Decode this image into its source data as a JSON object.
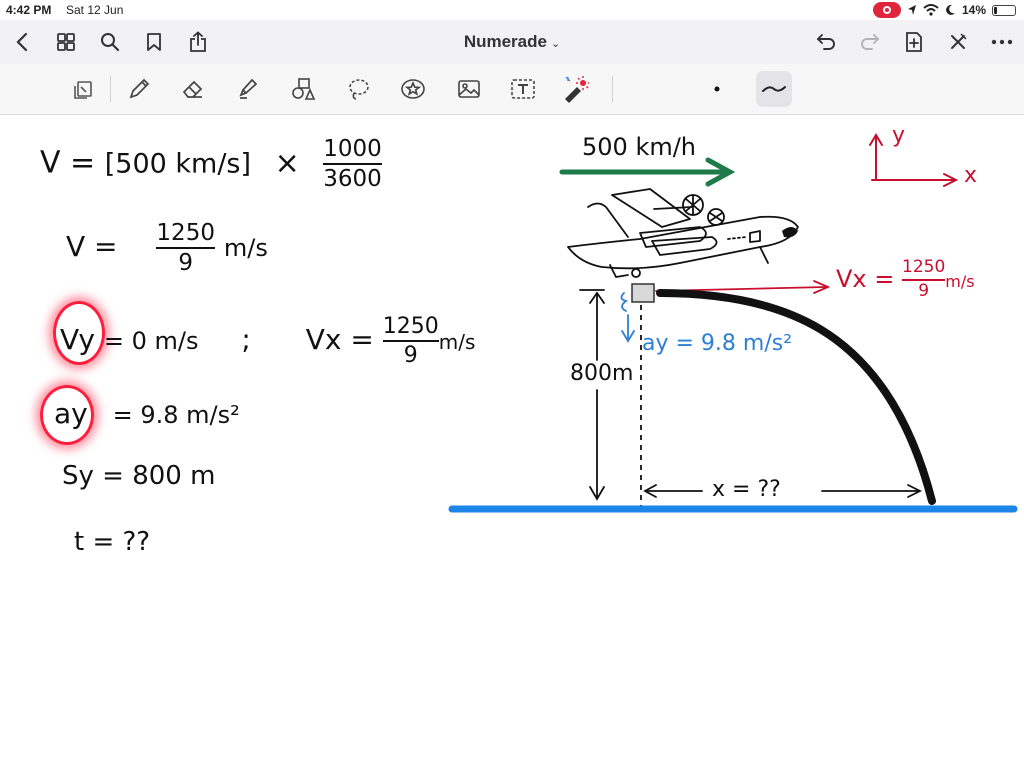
{
  "status_bar": {
    "time": "4:42 PM",
    "date": "Sat 12 Jun",
    "battery": "14%",
    "battery_level": 0.14,
    "icons": [
      "screen-record-icon",
      "location-icon",
      "wifi-icon",
      "moon-icon",
      "battery-icon"
    ]
  },
  "nav": {
    "title": "Numerade",
    "left_icons": [
      "back-icon",
      "grid-icon",
      "search-icon",
      "bookmark-icon",
      "share-icon"
    ],
    "right_icons": [
      "undo-icon",
      "redo-icon",
      "add-page-icon",
      "close-icon",
      "more-icon"
    ]
  },
  "toolbar": {
    "tools": [
      "document-icon",
      "pen-icon",
      "eraser-icon",
      "highlighter-icon",
      "shapes-icon",
      "lasso-icon",
      "sticker-icon",
      "image-icon",
      "text-icon",
      "laser-pointer-icon"
    ],
    "pen_size_icon": "dot-icon",
    "selected_tool": "stroke-style-icon"
  },
  "colors": {
    "ink": "#111111",
    "red": "#c8102e",
    "blue": "#2d7fd6",
    "green": "#1f7a4a",
    "highlight": "#ff1e3c"
  },
  "notes": {
    "line1_lhs": "V = ",
    "line1_bracket": "[500 km/s]",
    "line1_times": "×",
    "line1_num": "1000",
    "line1_den": "3600",
    "line2_lhs": "V = ",
    "line2_num": "1250",
    "line2_den": "9",
    "line2_unit": "m/s",
    "line3_vy": "Vy",
    "line3_rest": "= 0 m/s",
    "line3_semicolon": ";",
    "line3_vx": "Vx = ",
    "line3_num": "1250",
    "line3_den": "9",
    "line3_unit": "m/s",
    "line4_ay": "ay",
    "line4_rest": "= 9.8 m/s²",
    "line5": "Sy = 800 m",
    "line6": "t = ??"
  },
  "diagram": {
    "speed_label": "500 km/h",
    "axis_y": "y",
    "axis_x": "x",
    "vx_lhs": "Vx = ",
    "vx_num": "1250",
    "vx_den": "9",
    "vx_unit": "m/s",
    "ay_label": "ay = 9.8 m/s²",
    "height_label": "800m",
    "distance_label": "x = ??"
  }
}
